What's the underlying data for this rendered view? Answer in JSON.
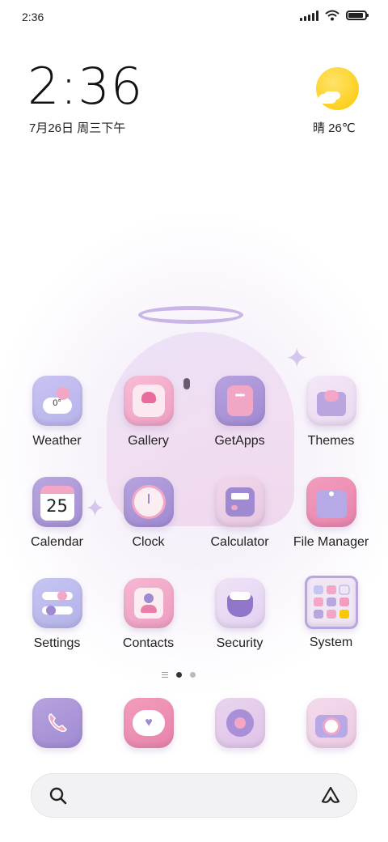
{
  "status_bar": {
    "time": "2:36",
    "battery_level": 0.9
  },
  "clock_widget": {
    "time": "2:36",
    "date": "7月26日 周三下午"
  },
  "weather_widget": {
    "text": "晴 26℃"
  },
  "apps": [
    {
      "label": "Weather",
      "icon": "weather-icon",
      "badge": "0°"
    },
    {
      "label": "Gallery",
      "icon": "gallery-icon"
    },
    {
      "label": "GetApps",
      "icon": "getapps-icon"
    },
    {
      "label": "Themes",
      "icon": "themes-icon"
    },
    {
      "label": "Calendar",
      "icon": "calendar-icon",
      "badge": "25"
    },
    {
      "label": "Clock",
      "icon": "clock-icon"
    },
    {
      "label": "Calculator",
      "icon": "calculator-icon"
    },
    {
      "label": "File Manager",
      "icon": "file-manager-icon"
    },
    {
      "label": "Settings",
      "icon": "settings-icon"
    },
    {
      "label": "Contacts",
      "icon": "contacts-icon"
    },
    {
      "label": "Security",
      "icon": "security-icon"
    },
    {
      "label": "System",
      "icon": "system-folder-icon"
    }
  ],
  "page_indicator": {
    "pages": 2,
    "current": 1
  },
  "dock": [
    {
      "icon": "phone-icon"
    },
    {
      "icon": "messages-icon"
    },
    {
      "icon": "browser-icon"
    },
    {
      "icon": "camera-icon"
    }
  ],
  "colors": {
    "sun": "#fcc800",
    "lavender": "#b9a6df",
    "pink": "#f3a6c6",
    "icon_bg_light": "#f2e7f7"
  }
}
